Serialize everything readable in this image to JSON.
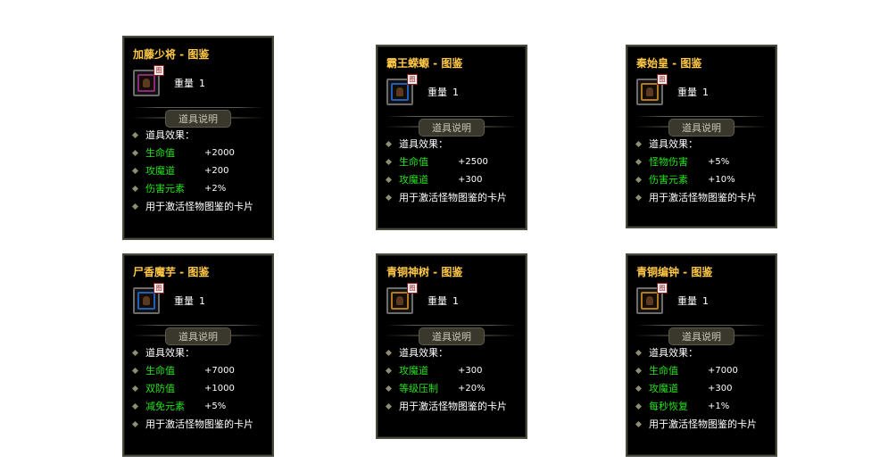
{
  "colors": {
    "title": "#ffc847",
    "stat": "#25e21d",
    "text": "#ffffff",
    "border": "#4b4a3e"
  },
  "cards": [
    {
      "title": "加藤少将 - 图鉴",
      "icon": "purple-card-icon",
      "icon_color": "#8a2a7a",
      "badge": "图",
      "weight_label": "重量",
      "weight_value": "1",
      "section_label": "道具说明",
      "effect_header": "道具效果：",
      "stats": [
        {
          "name": "生命值",
          "value": "+2000"
        },
        {
          "name": "攻魔道",
          "value": "+200"
        },
        {
          "name": "伤害元素",
          "value": "+2%"
        }
      ],
      "description": "用于激活怪物图鉴的卡片"
    },
    {
      "title": "霸王蝾螈 - 图鉴",
      "icon": "blue-card-icon",
      "icon_color": "#1f5fb8",
      "badge": "图",
      "weight_label": "重量",
      "weight_value": "1",
      "section_label": "道具说明",
      "effect_header": "道具效果：",
      "stats": [
        {
          "name": "生命值",
          "value": "+2500"
        },
        {
          "name": "攻魔道",
          "value": "+300"
        }
      ],
      "description": "用于激活怪物图鉴的卡片"
    },
    {
      "title": "秦始皇 - 图鉴",
      "icon": "gold-card-icon",
      "icon_color": "#b07a20",
      "badge": "图",
      "weight_label": "重量",
      "weight_value": "1",
      "section_label": "道具说明",
      "effect_header": "道具效果：",
      "stats": [
        {
          "name": "怪物伤害",
          "value": "+5%"
        },
        {
          "name": "伤害元素",
          "value": "+10%"
        }
      ],
      "description": "用于激活怪物图鉴的卡片"
    },
    {
      "title": "尸香魔芋 - 图鉴",
      "icon": "blue-card-icon",
      "icon_color": "#1f5fb8",
      "badge": "图",
      "weight_label": "重量",
      "weight_value": "1",
      "section_label": "道具说明",
      "effect_header": "道具效果：",
      "stats": [
        {
          "name": "生命值",
          "value": "+7000"
        },
        {
          "name": "双防值",
          "value": "+1000"
        },
        {
          "name": "减免元素",
          "value": "+5%"
        }
      ],
      "description": "用于激活怪物图鉴的卡片"
    },
    {
      "title": "青铜神树 - 图鉴",
      "icon": "gold-card-icon",
      "icon_color": "#b07a20",
      "badge": "图",
      "weight_label": "重量",
      "weight_value": "1",
      "section_label": "道具说明",
      "effect_header": "道具效果：",
      "stats": [
        {
          "name": "攻魔道",
          "value": "+300"
        },
        {
          "name": "等级压制",
          "value": "+20%"
        }
      ],
      "description": "用于激活怪物图鉴的卡片"
    },
    {
      "title": "青铜编钟 - 图鉴",
      "icon": "gold-card-icon",
      "icon_color": "#b07a20",
      "badge": "图",
      "weight_label": "重量",
      "weight_value": "1",
      "section_label": "道具说明",
      "effect_header": "道具效果：",
      "stats": [
        {
          "name": "生命值",
          "value": "+7000"
        },
        {
          "name": "攻魔道",
          "value": "+300"
        },
        {
          "name": "每秒恢复",
          "value": "+1%"
        }
      ],
      "description": "用于激活怪物图鉴的卡片"
    }
  ]
}
